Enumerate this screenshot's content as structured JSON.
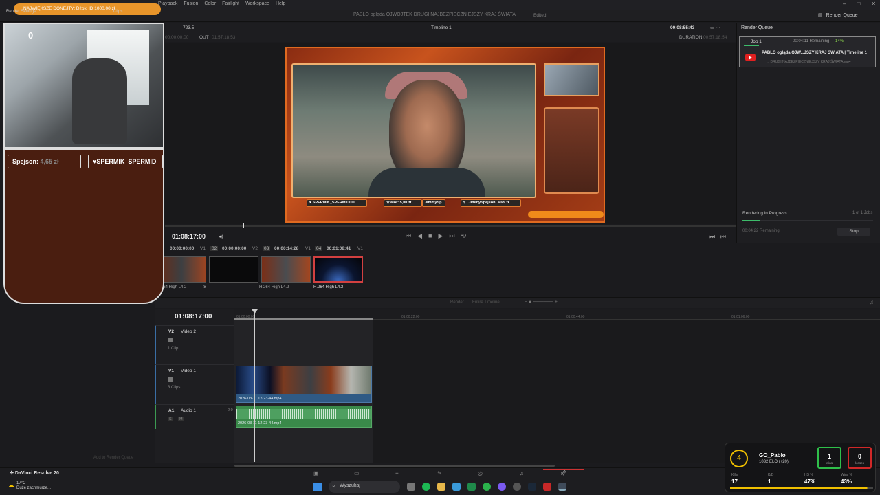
{
  "menu": {
    "items": [
      "Playback",
      "Fusion",
      "Color",
      "Fairlight",
      "Workspace",
      "Help"
    ]
  },
  "titlebar": {
    "project": "PABLO ogląda OJWOJTEK DRUGI NAJBEZPIECZNIEJSZY KRAJ ŚWIATA",
    "edited": "Edited",
    "render_queue_button": "Render Queue",
    "render_settings": "Render Settings",
    "clips": "Clips"
  },
  "viewer": {
    "zoom": "723.5",
    "timeline_name": "Timeline 1",
    "timecode_top": "00:08:55:43",
    "out_label": "OUT",
    "out_tc": "01:57:18:53",
    "in_tc": "00:00:00:00",
    "duration_label": "DURATION",
    "duration_tc": "00:57:18:54",
    "current_tc": "01:08:17:00",
    "overlay": {
      "donor1": "SPERMIK_SPERMIDLO",
      "donor2": "wior: 5,00 zł",
      "donor2_name": "JimmySp",
      "donor3": "JimmySpejson: 4,65 zł",
      "dollar": "$"
    }
  },
  "clip_strip": {
    "clips": [
      {
        "tc": "00:00:00:00",
        "track": "V1",
        "index": "02",
        "codec": "H.264 High L4.2"
      },
      {
        "tc": "00:00:00:00",
        "track": "V2",
        "index": "03",
        "codec": "fx"
      },
      {
        "tc": "00:00:14:28",
        "track": "V1",
        "index": "04",
        "codec": "H.264 High L4.2"
      },
      {
        "tc": "00:01:08:41",
        "track": "V1",
        "index": "",
        "codec": "H.264 High L4.2"
      }
    ]
  },
  "timeline": {
    "toolbar": {
      "render_label": "Render",
      "entire_timeline": "Entire Timeline"
    },
    "timecode": "01:08:17:00",
    "ruler": [
      "01:00:00:00",
      "01:00:22:00",
      "01:00:44:00",
      "01:01:06:00"
    ],
    "tracks": [
      {
        "id": "V2",
        "title": "Video 2",
        "count": "1 Clip"
      },
      {
        "id": "V1",
        "title": "Video 1",
        "count": "3 Clips"
      },
      {
        "id": "A1",
        "title": "Audio 1",
        "count": "2.0"
      }
    ],
    "v1_clip_name": "2026-03-11 12-23-44.mp4",
    "a1_clip_name": "2026-03-11 12-23-44.mp4",
    "add_to_queue": "Add to Render Queue"
  },
  "render_queue": {
    "title": "Render Queue",
    "job": {
      "label": "Job 1",
      "remaining": "00:04:11 Remaining",
      "pct": "14%",
      "title": "PABLO ogląda OJW...JSZY KRAJ ŚWIATA | Timeline 1",
      "sub": "... DRUGI NAJBEZPIECZNIEJSZY KRAJ ŚWIATA.mp4"
    },
    "in_progress": "Rendering in Progress",
    "count": "1 of 1 Jobs",
    "remaining": "00:04:22 Remaining",
    "stop": "Stop"
  },
  "stream_overlay": {
    "donation_pill": "NAJWIĘKSZE DONEJTY:  Dżoki ID  1000,00 zł",
    "tip1_name": "Spejson:",
    "tip1_amount": "4,65 zł",
    "tip2_name": "SPERMIK_SPERMID",
    "cam_count": "0"
  },
  "taskbar": {
    "app": "DaVinci Resolve 20",
    "temp": "17°C",
    "weather": "Duże zachmurze...",
    "search": "Wyszukaj"
  },
  "faceit": {
    "level": "4",
    "name": "GO_Pablo",
    "elo": "1032 ELO (+20)",
    "wins": "1",
    "wins_label": "wins",
    "losses": "0",
    "losses_label": "losses",
    "stats": [
      {
        "label": "Kills",
        "value": "17"
      },
      {
        "label": "K/D",
        "value": "1"
      },
      {
        "label": "HS %",
        "value": "47%"
      },
      {
        "label": "Wins %",
        "value": "43%"
      }
    ]
  }
}
